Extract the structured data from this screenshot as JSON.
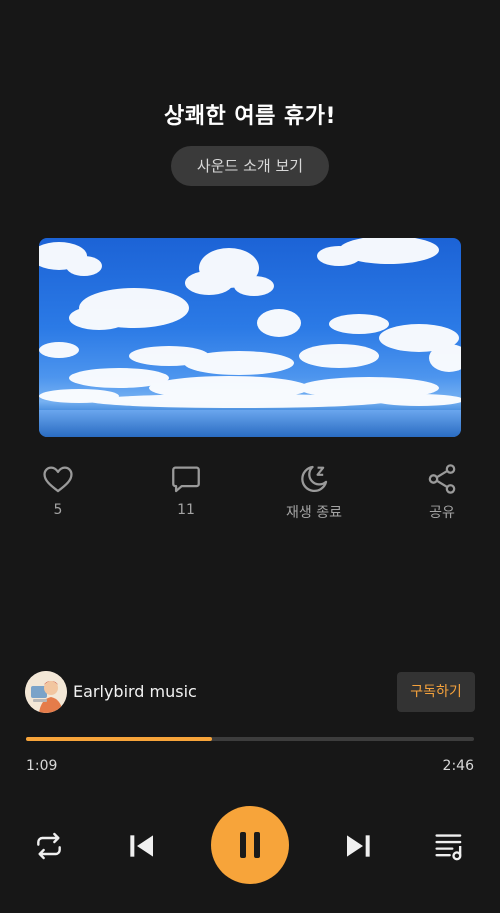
{
  "title": "상쾌한 여름 휴가!",
  "intro_button": "사운드 소개 보기",
  "cover": {
    "icon": "sky-clouds-image"
  },
  "actions": [
    {
      "icon": "heart-icon",
      "label": "5"
    },
    {
      "icon": "comment-icon",
      "label": "11"
    },
    {
      "icon": "sleep-timer-icon",
      "label": "재생 종료"
    },
    {
      "icon": "share-icon",
      "label": "공유"
    }
  ],
  "channel": {
    "name": "Earlybird music",
    "subscribe_label": "구독하기"
  },
  "player": {
    "elapsed": "1:09",
    "duration": "2:46",
    "progress_fraction": 0.415,
    "accent_color": "#f7a43a"
  },
  "controls": {
    "repeat_icon": "repeat-icon",
    "previous_icon": "skip-previous-icon",
    "pause_icon": "pause-icon",
    "next_icon": "skip-next-icon",
    "playlist_icon": "playlist-icon"
  }
}
